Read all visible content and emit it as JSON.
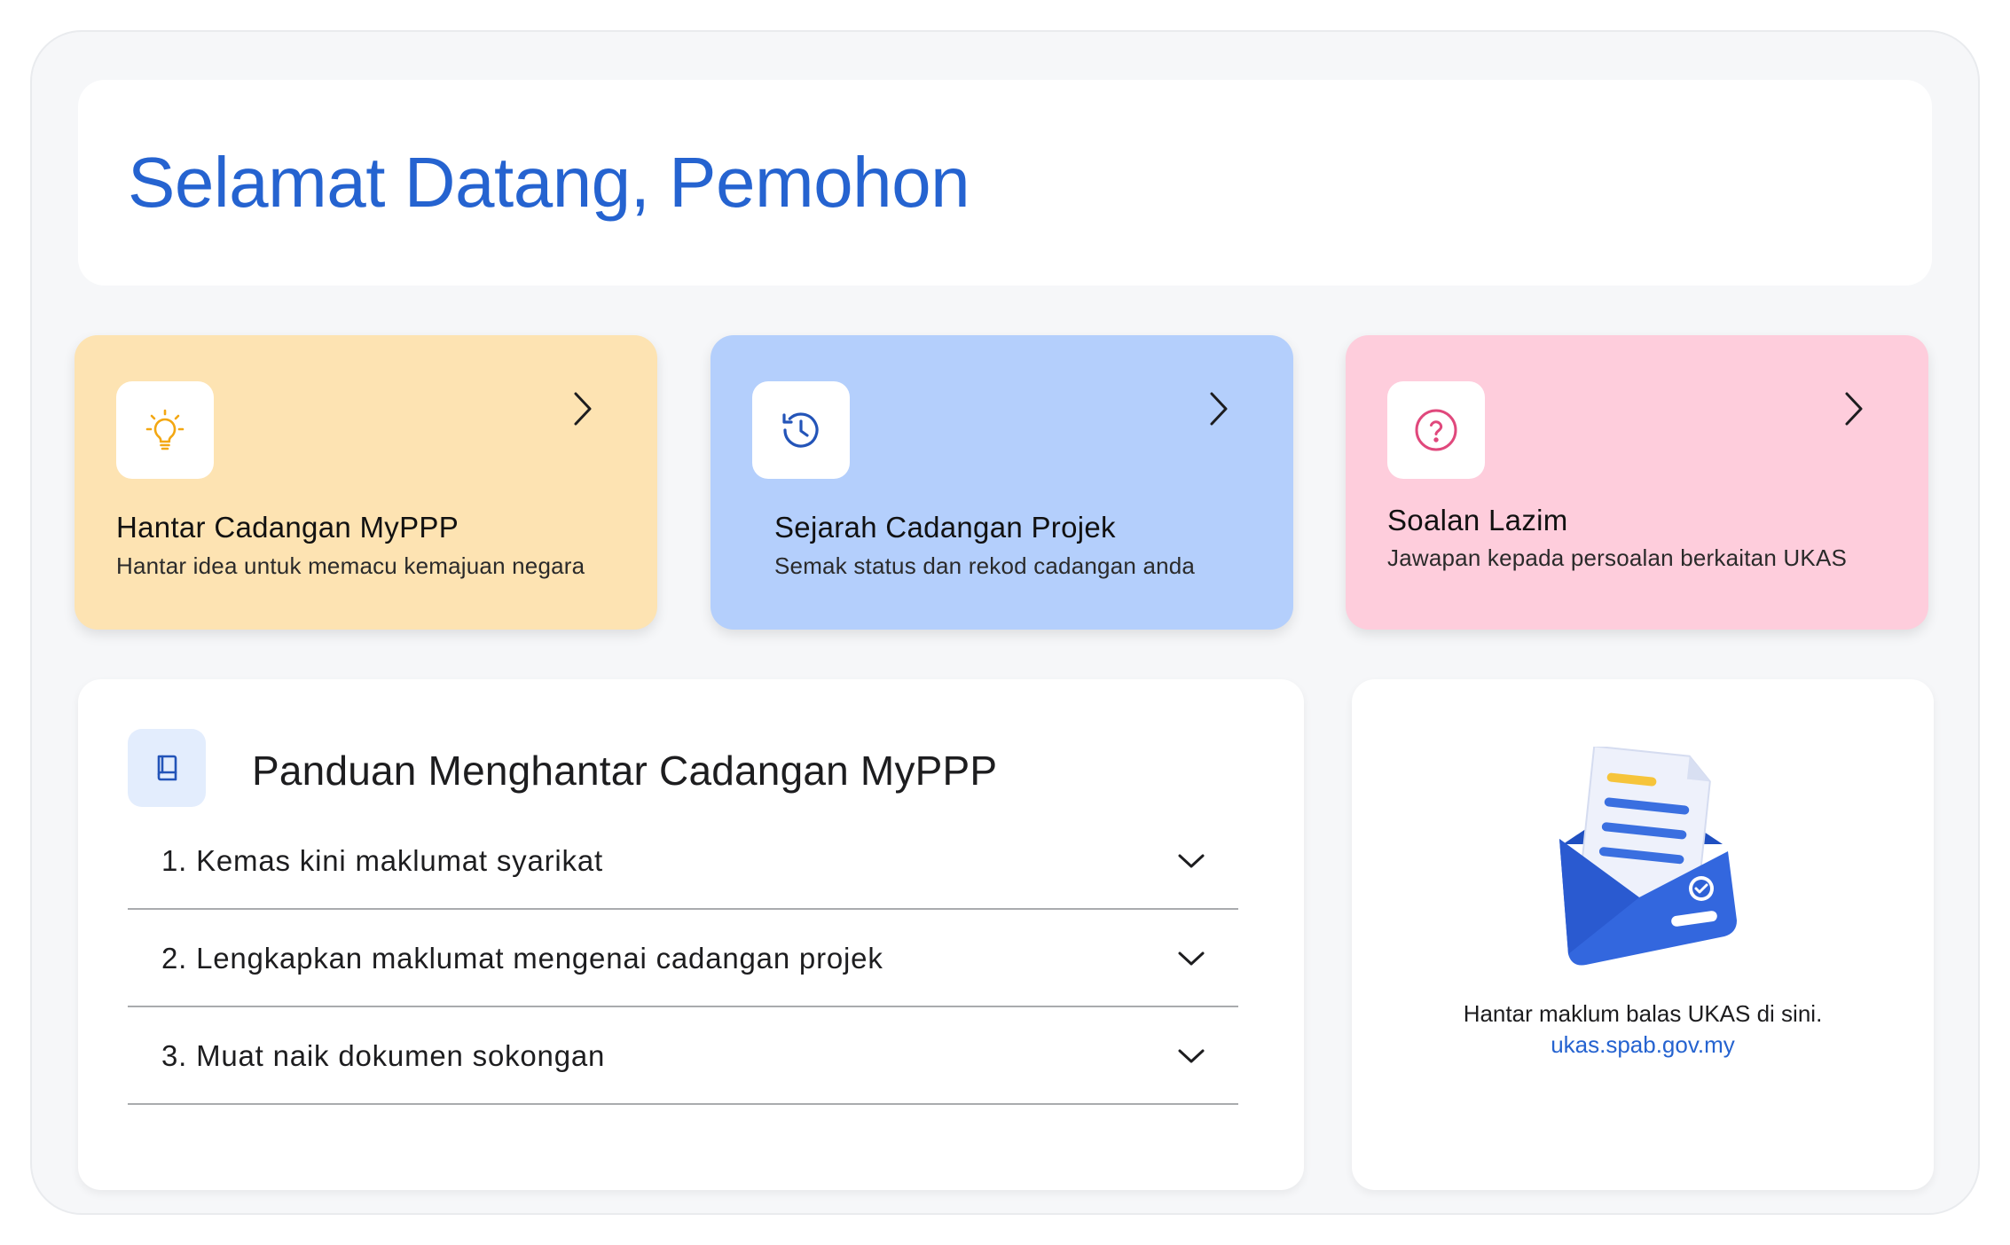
{
  "welcome": {
    "title": "Selamat Datang, Pemohon"
  },
  "cards": [
    {
      "title": "Hantar Cadangan MyPPP",
      "subtitle": "Hantar idea untuk memacu kemajuan negara",
      "icon": "lightbulb-icon",
      "bg": "#fde3b2",
      "icon_color": "#f3a712"
    },
    {
      "title": "Sejarah Cadangan Projek",
      "subtitle": "Semak status dan rekod cadangan anda",
      "icon": "history-icon",
      "bg": "#b4cffc",
      "icon_color": "#2354b8"
    },
    {
      "title": "Soalan Lazim",
      "subtitle": "Jawapan kepada persoalan berkaitan UKAS",
      "icon": "question-circle-icon",
      "bg": "#fecddc",
      "icon_color": "#e0487c"
    }
  ],
  "guide": {
    "title": "Panduan Menghantar Cadangan MyPPP",
    "icon": "book-icon",
    "steps": [
      {
        "label": "1. Kemas kini maklumat syarikat"
      },
      {
        "label": "2. Lengkapkan maklumat mengenai cadangan projek"
      },
      {
        "label": "3. Muat naik dokumen sokongan"
      }
    ]
  },
  "feedback": {
    "text": "Hantar maklum balas UKAS di sini.",
    "link": "ukas.spab.gov.my",
    "illustration": "envelope-letter-illustration"
  },
  "colors": {
    "accent": "#2563d0",
    "frame": "#f6f7f9"
  }
}
